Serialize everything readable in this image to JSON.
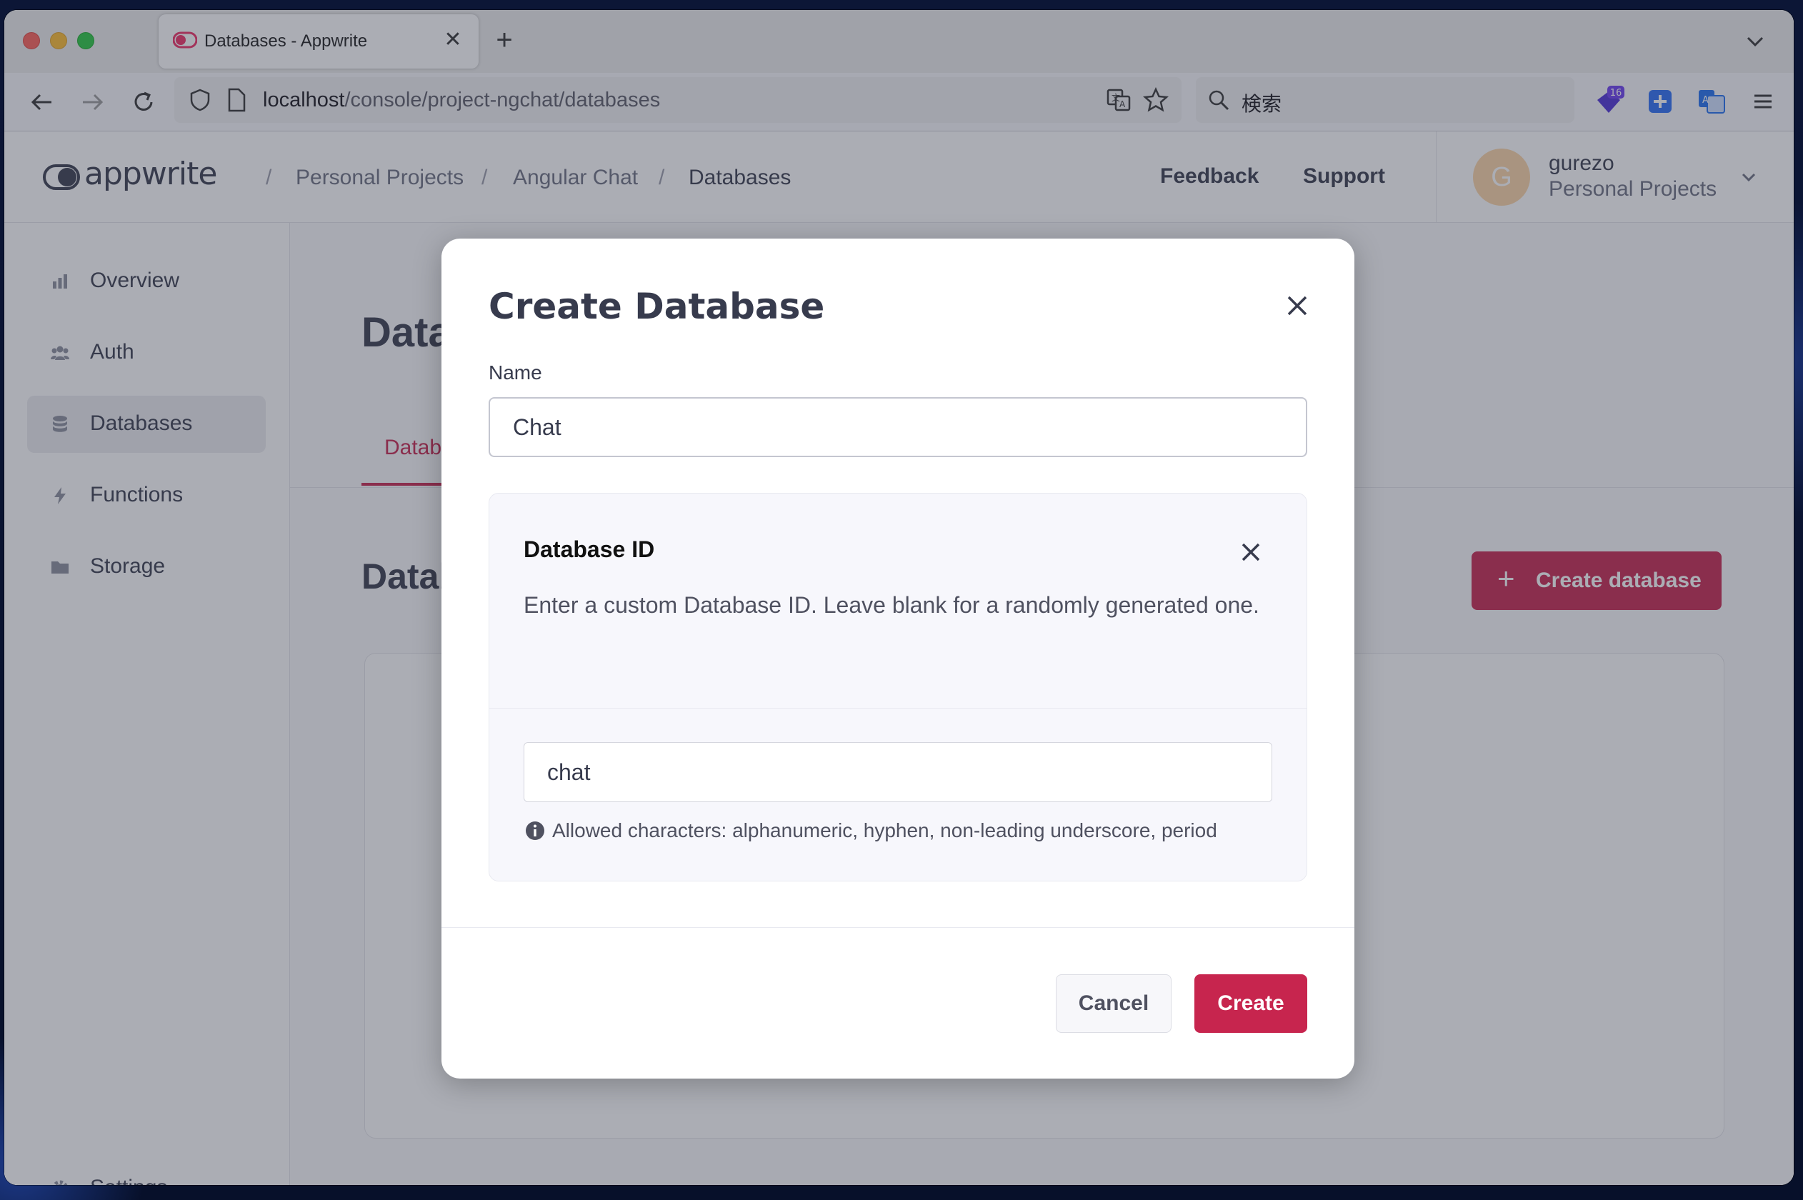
{
  "browser": {
    "tab_title": "Databases - Appwrite",
    "url_host": "localhost",
    "url_path": "/console/project-ngchat/databases",
    "search_placeholder": "検索",
    "extension_badge": "16"
  },
  "header": {
    "logo": "appwrite",
    "breadcrumbs": [
      "Personal Projects",
      "Angular Chat",
      "Databases"
    ],
    "feedback": "Feedback",
    "support": "Support",
    "user_initial": "G",
    "user_name": "gurezo",
    "user_org": "Personal Projects"
  },
  "sidebar": {
    "items": [
      {
        "label": "Overview",
        "icon": "chart-icon"
      },
      {
        "label": "Auth",
        "icon": "users-icon"
      },
      {
        "label": "Databases",
        "icon": "database-icon",
        "active": true
      },
      {
        "label": "Functions",
        "icon": "lightning-icon"
      },
      {
        "label": "Storage",
        "icon": "folder-icon"
      }
    ],
    "settings": "Settings"
  },
  "page": {
    "title": "Databases",
    "tab": "Databases",
    "section_title": "Databases",
    "create_button": "Create database"
  },
  "modal": {
    "title": "Create Database",
    "name_label": "Name",
    "name_value": "Chat",
    "id_title": "Database ID",
    "id_description": "Enter a custom Database ID. Leave blank for a randomly generated one.",
    "id_value": "chat",
    "hint": "Allowed characters: alphanumeric, hyphen, non-leading underscore, period",
    "cancel": "Cancel",
    "create": "Create"
  },
  "colors": {
    "accent": "#c7254e",
    "text": "#373b4d"
  }
}
